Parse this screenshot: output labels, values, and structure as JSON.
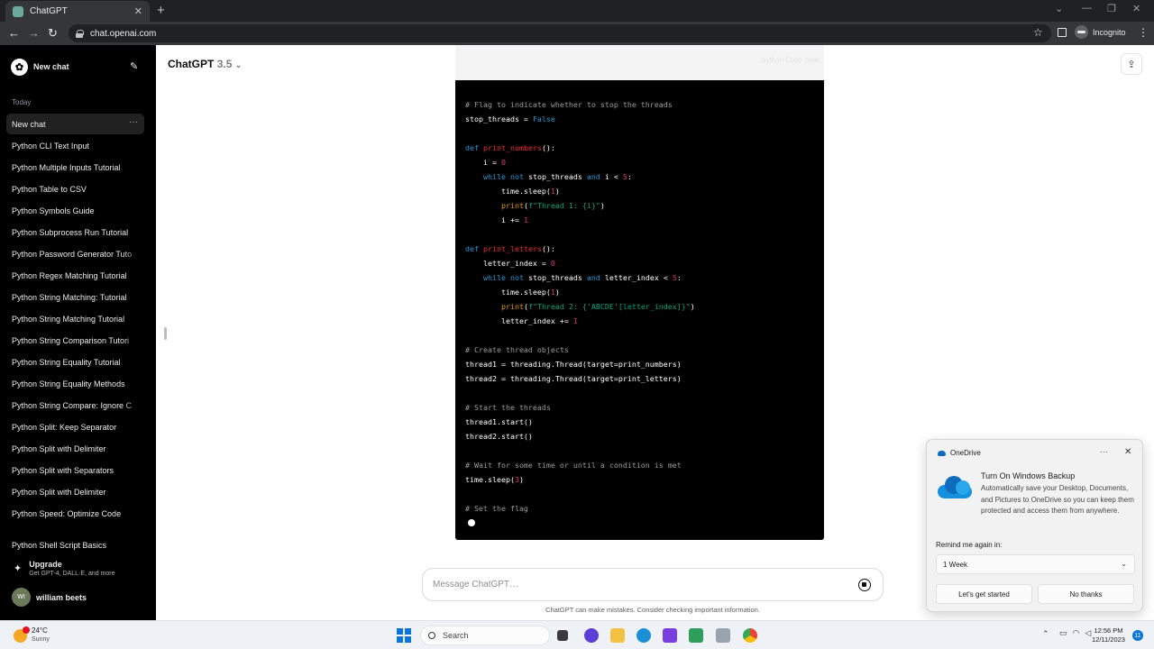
{
  "browser": {
    "tab_title": "ChatGPT",
    "url": "chat.openai.com",
    "profile": "Incognito"
  },
  "sidebar": {
    "new_chat": "New chat",
    "section_today": "Today",
    "items": [
      "New chat",
      "Python CLI Text Input",
      "Python Multiple Inputs Tutorial",
      "Python Table to CSV",
      "Python Symbols Guide",
      "Python Subprocess Run Tutorial",
      "Python Password Generator Tuto",
      "Python Regex Matching Tutorial",
      "Python String Matching: Tutorial",
      "Python String Matching Tutorial",
      "Python String Comparison Tutori",
      "Python String Equality Tutorial",
      "Python String Equality Methods",
      "Python String Compare: Ignore C",
      "Python Split: Keep Separator",
      "Python Split with Delimiter",
      "Python Split with Separators",
      "Python Split with Delimiter",
      "Python Speed: Optimize Code",
      "Python Shell Script Basics"
    ],
    "upgrade_title": "Upgrade",
    "upgrade_sub": "Get GPT-4, DALL·E, and more",
    "user_initials": "WI",
    "user_name": "william beets"
  },
  "main": {
    "model_name": "ChatGPT",
    "model_version": "3.5",
    "composer_placeholder": "Message ChatGPT…",
    "disclaimer": "ChatGPT can make mistakes. Consider checking important information.",
    "code_header_faint": "python     Copy code"
  },
  "code_lines": [
    "# Flag to indicate whether to stop the threads",
    "stop_threads = False",
    "def print_numbers():",
    "i = 0",
    "while not stop_threads and i < 5:",
    "time.sleep(1)",
    "print(f\"Thread 1: {i}\")",
    "i += 1",
    "def print_letters():",
    "letter_index = 0",
    "while not stop_threads and letter_index < 5:",
    "time.sleep(1)",
    "print(f\"Thread 2: {'ABCDE'[letter_index]}\")",
    "letter_index += 1",
    "# Create thread objects",
    "thread1 = threading.Thread(target=print_numbers)",
    "thread2 = threading.Thread(target=print_letters)",
    "# Start the threads",
    "thread1.start()",
    "thread2.start()",
    "# Wait for some time or until a condition is met",
    "time.sleep(3)",
    "# Set the flag"
  ],
  "onedrive_toast": {
    "app": "OneDrive",
    "title": "Turn On Windows Backup",
    "body": "Automatically save your Desktop, Documents, and Pictures to OneDrive so you can keep them protected and access them from anywhere.",
    "remind_label": "Remind me again in:",
    "remind_value": "1 Week",
    "primary_button": "Let's get started",
    "secondary_button": "No thanks"
  },
  "taskbar": {
    "temp": "24°C",
    "condition": "Sunny",
    "search": "Search",
    "time": "12:56 PM",
    "date": "12/11/2023",
    "notifications": "11"
  },
  "colors": {
    "sidebar_bg": "#000000",
    "code_bg": "#000000",
    "keyword": "#2e95d3",
    "function": "#f22c3d",
    "string": "#00a67d",
    "number": "#df3079",
    "comment": "#9b9b9b"
  }
}
